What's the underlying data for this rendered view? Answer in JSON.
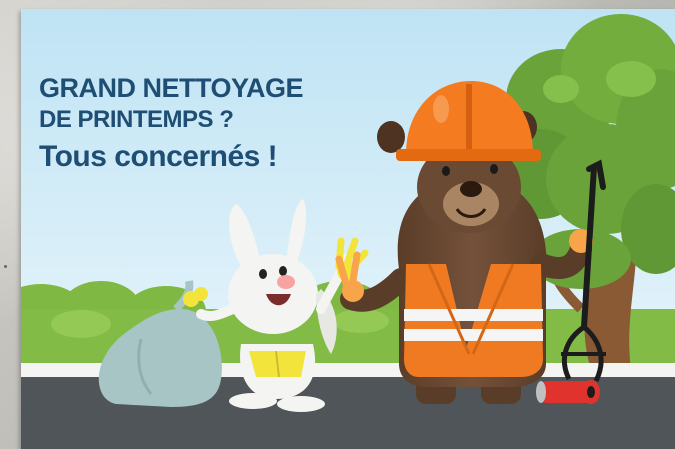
{
  "poster": {
    "headline_line1": "GRAND NETTOYAGE",
    "headline_line2": "DE PRINTEMPS ?",
    "headline_line3": "Tous concernés !"
  },
  "colors": {
    "headline": "#1f4e75",
    "sky_top": "#bfe3f4",
    "sky_bottom": "#e8f5fb",
    "road": "#4f5558",
    "bear_fur": "#6a4a32",
    "vest": "#f07a22",
    "helmet": "#f47b20",
    "tree": "#6aa33a",
    "bag": "#a7c5c4"
  },
  "icons": [
    "bear-character",
    "rabbit-character",
    "trash-bag-icon",
    "litter-picker-icon",
    "can-icon",
    "tree-icon"
  ]
}
